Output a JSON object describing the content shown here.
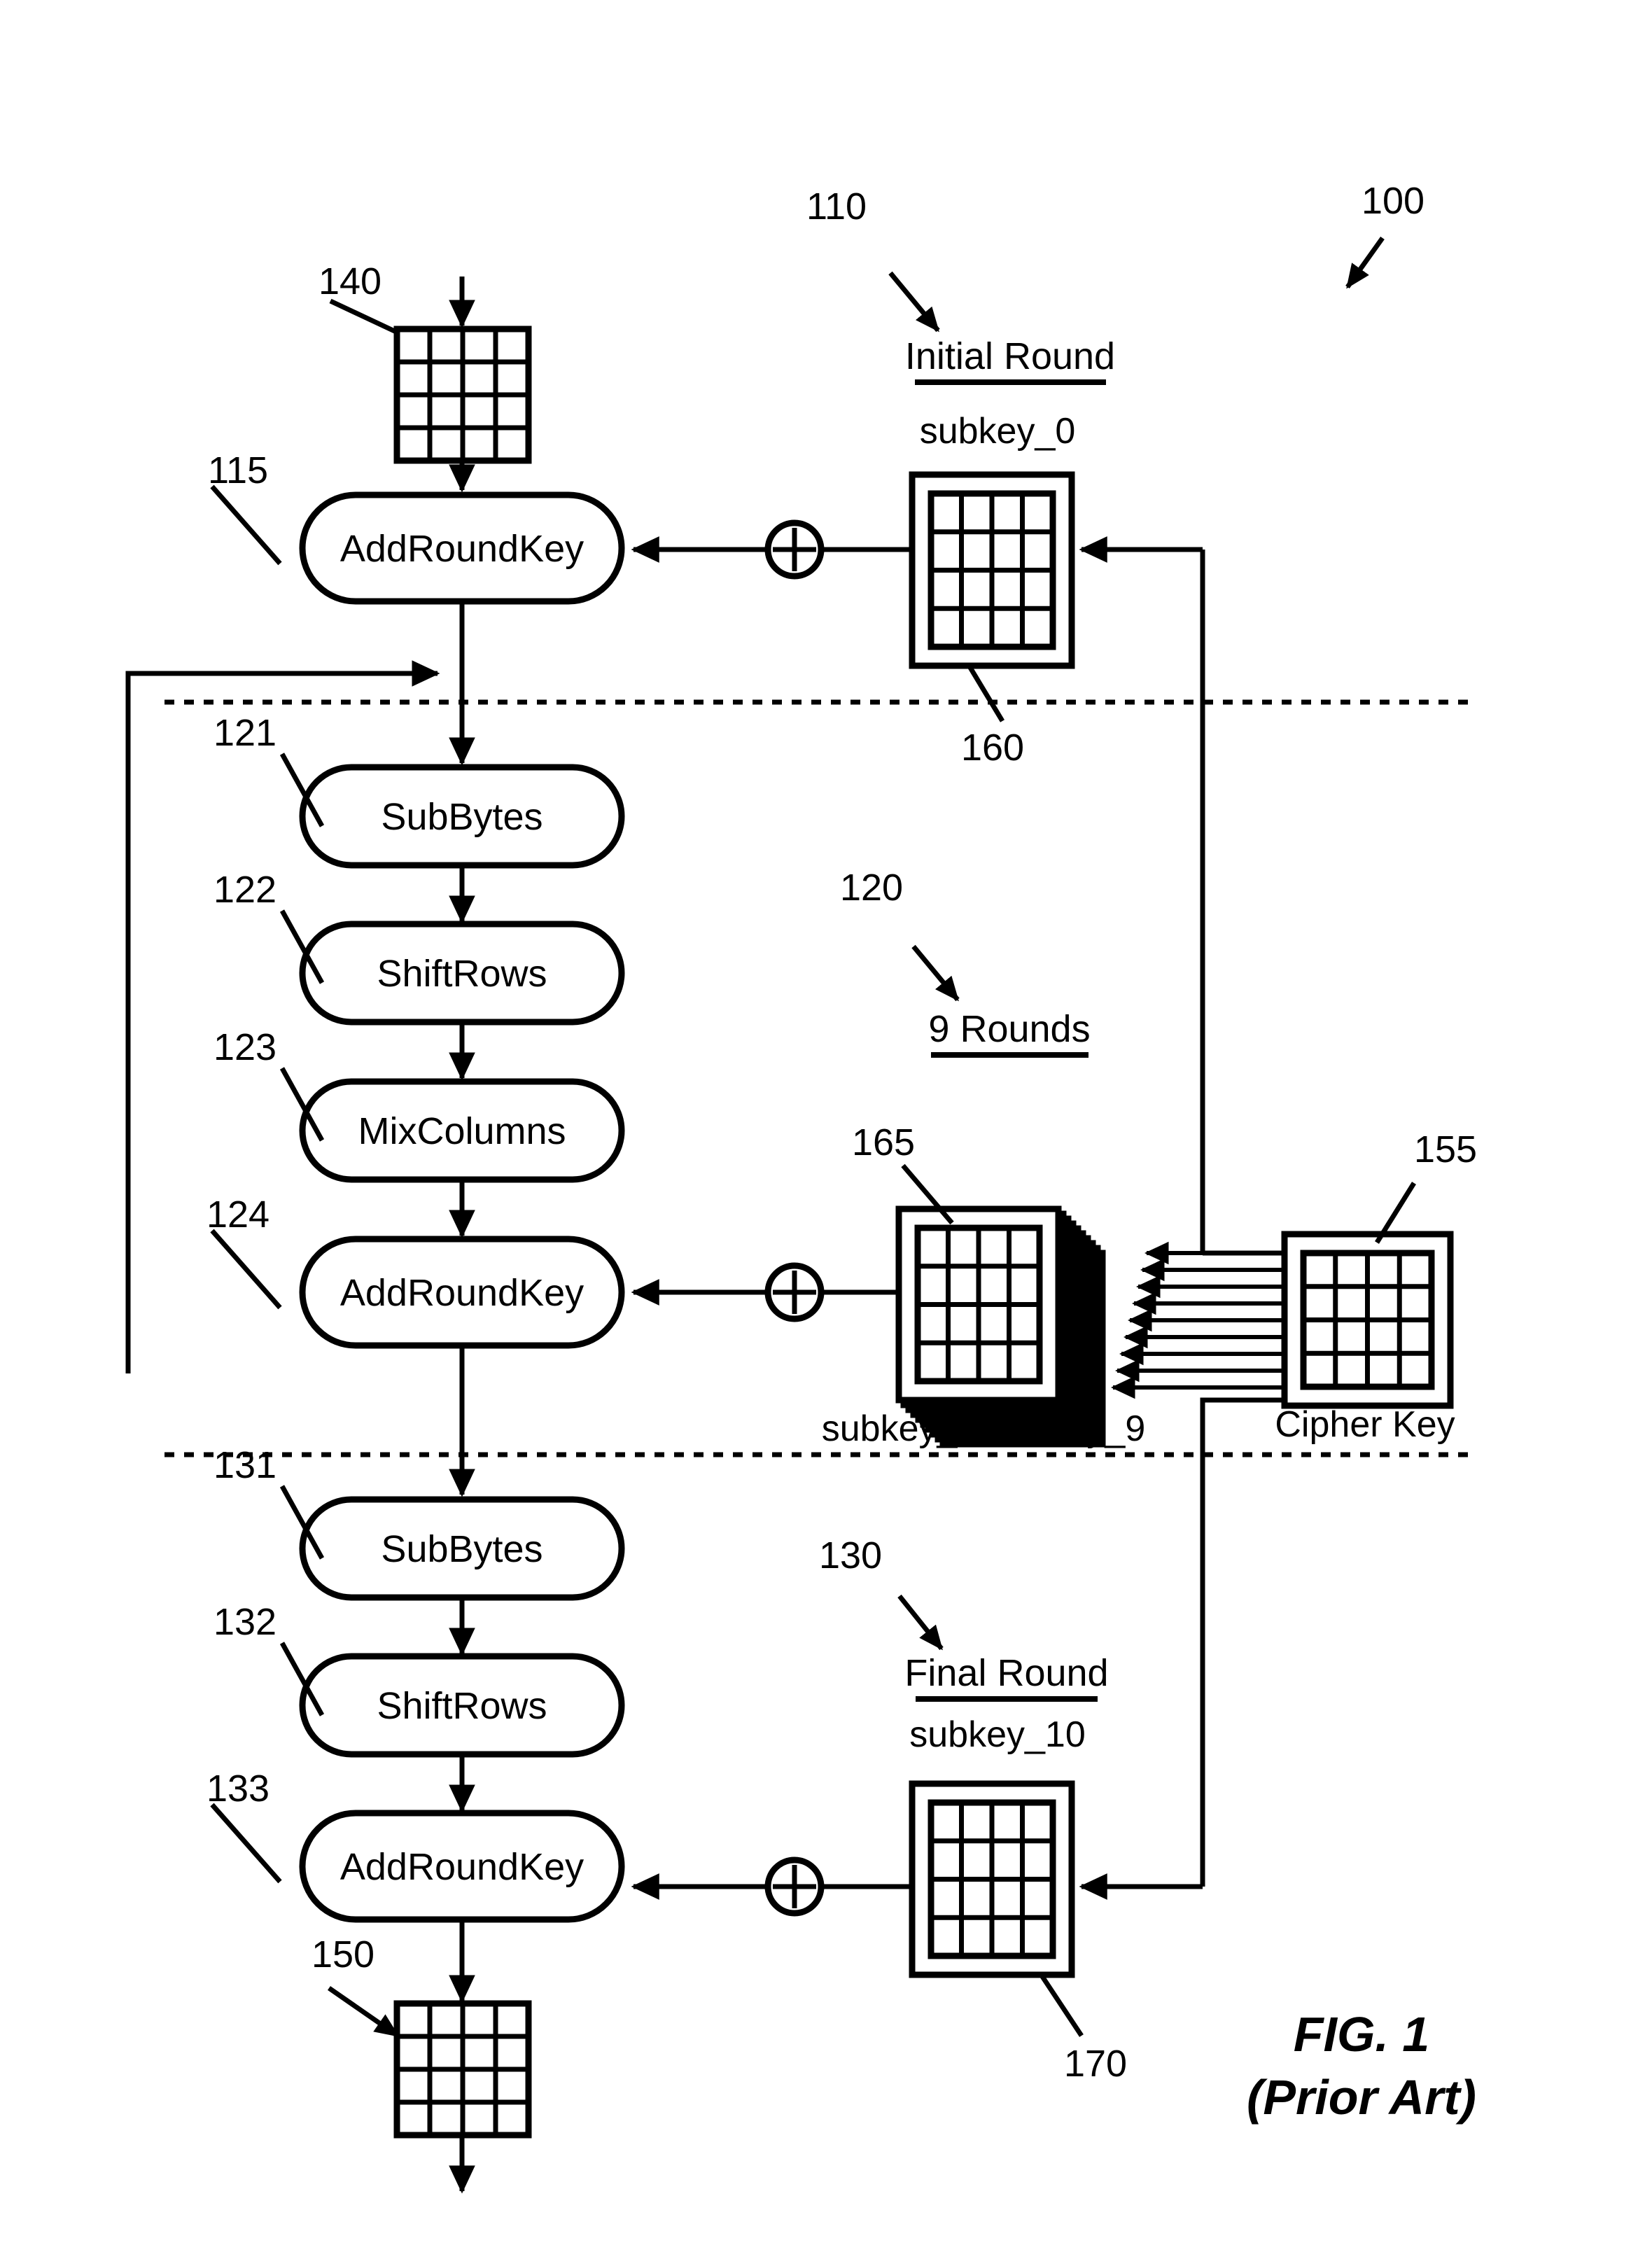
{
  "figure": {
    "caption_line1": "FIG. 1",
    "caption_line2": "(Prior Art)",
    "overall_ref": "100"
  },
  "sections": [
    {
      "ref": "110",
      "label": "Initial Round"
    },
    {
      "ref": "120",
      "label": "9 Rounds"
    },
    {
      "ref": "130",
      "label": "Final Round"
    }
  ],
  "operations": [
    {
      "ref": "115",
      "label": "AddRoundKey",
      "section": "initial"
    },
    {
      "ref": "121",
      "label": "SubBytes",
      "section": "rounds"
    },
    {
      "ref": "122",
      "label": "ShiftRows",
      "section": "rounds"
    },
    {
      "ref": "123",
      "label": "MixColumns",
      "section": "rounds"
    },
    {
      "ref": "124",
      "label": "AddRoundKey",
      "section": "rounds"
    },
    {
      "ref": "131",
      "label": "SubBytes",
      "section": "final"
    },
    {
      "ref": "132",
      "label": "ShiftRows",
      "section": "final"
    },
    {
      "ref": "133",
      "label": "AddRoundKey",
      "section": "final"
    }
  ],
  "state_matrices": [
    {
      "ref": "140",
      "name": "input-state-matrix",
      "rows": 4,
      "cols": 4
    },
    {
      "ref": "150",
      "name": "output-state-matrix",
      "rows": 4,
      "cols": 4
    }
  ],
  "keys": [
    {
      "ref": "160",
      "label": "subkey_0",
      "rows": 4,
      "cols": 4,
      "stacked": false
    },
    {
      "ref": "165",
      "label": "subkey_1-subkey_9",
      "rows": 4,
      "cols": 4,
      "stacked": true,
      "stack_count": 9
    },
    {
      "ref": "170",
      "label": "subkey_10",
      "rows": 4,
      "cols": 4,
      "stacked": false
    },
    {
      "ref": "155",
      "label": "Cipher Key",
      "rows": 4,
      "cols": 4,
      "stacked": false
    }
  ],
  "xor_nodes": [
    {
      "name": "xor-initial-round",
      "glyph": "+"
    },
    {
      "name": "xor-nine-rounds",
      "glyph": "+"
    },
    {
      "name": "xor-final-round",
      "glyph": "+"
    }
  ],
  "key_expansion": {
    "arrow_count": 9,
    "description_from": "Cipher Key",
    "description_to": "subkey_1-subkey_9"
  },
  "colors": {
    "stroke": "#000000",
    "background": "#ffffff"
  }
}
